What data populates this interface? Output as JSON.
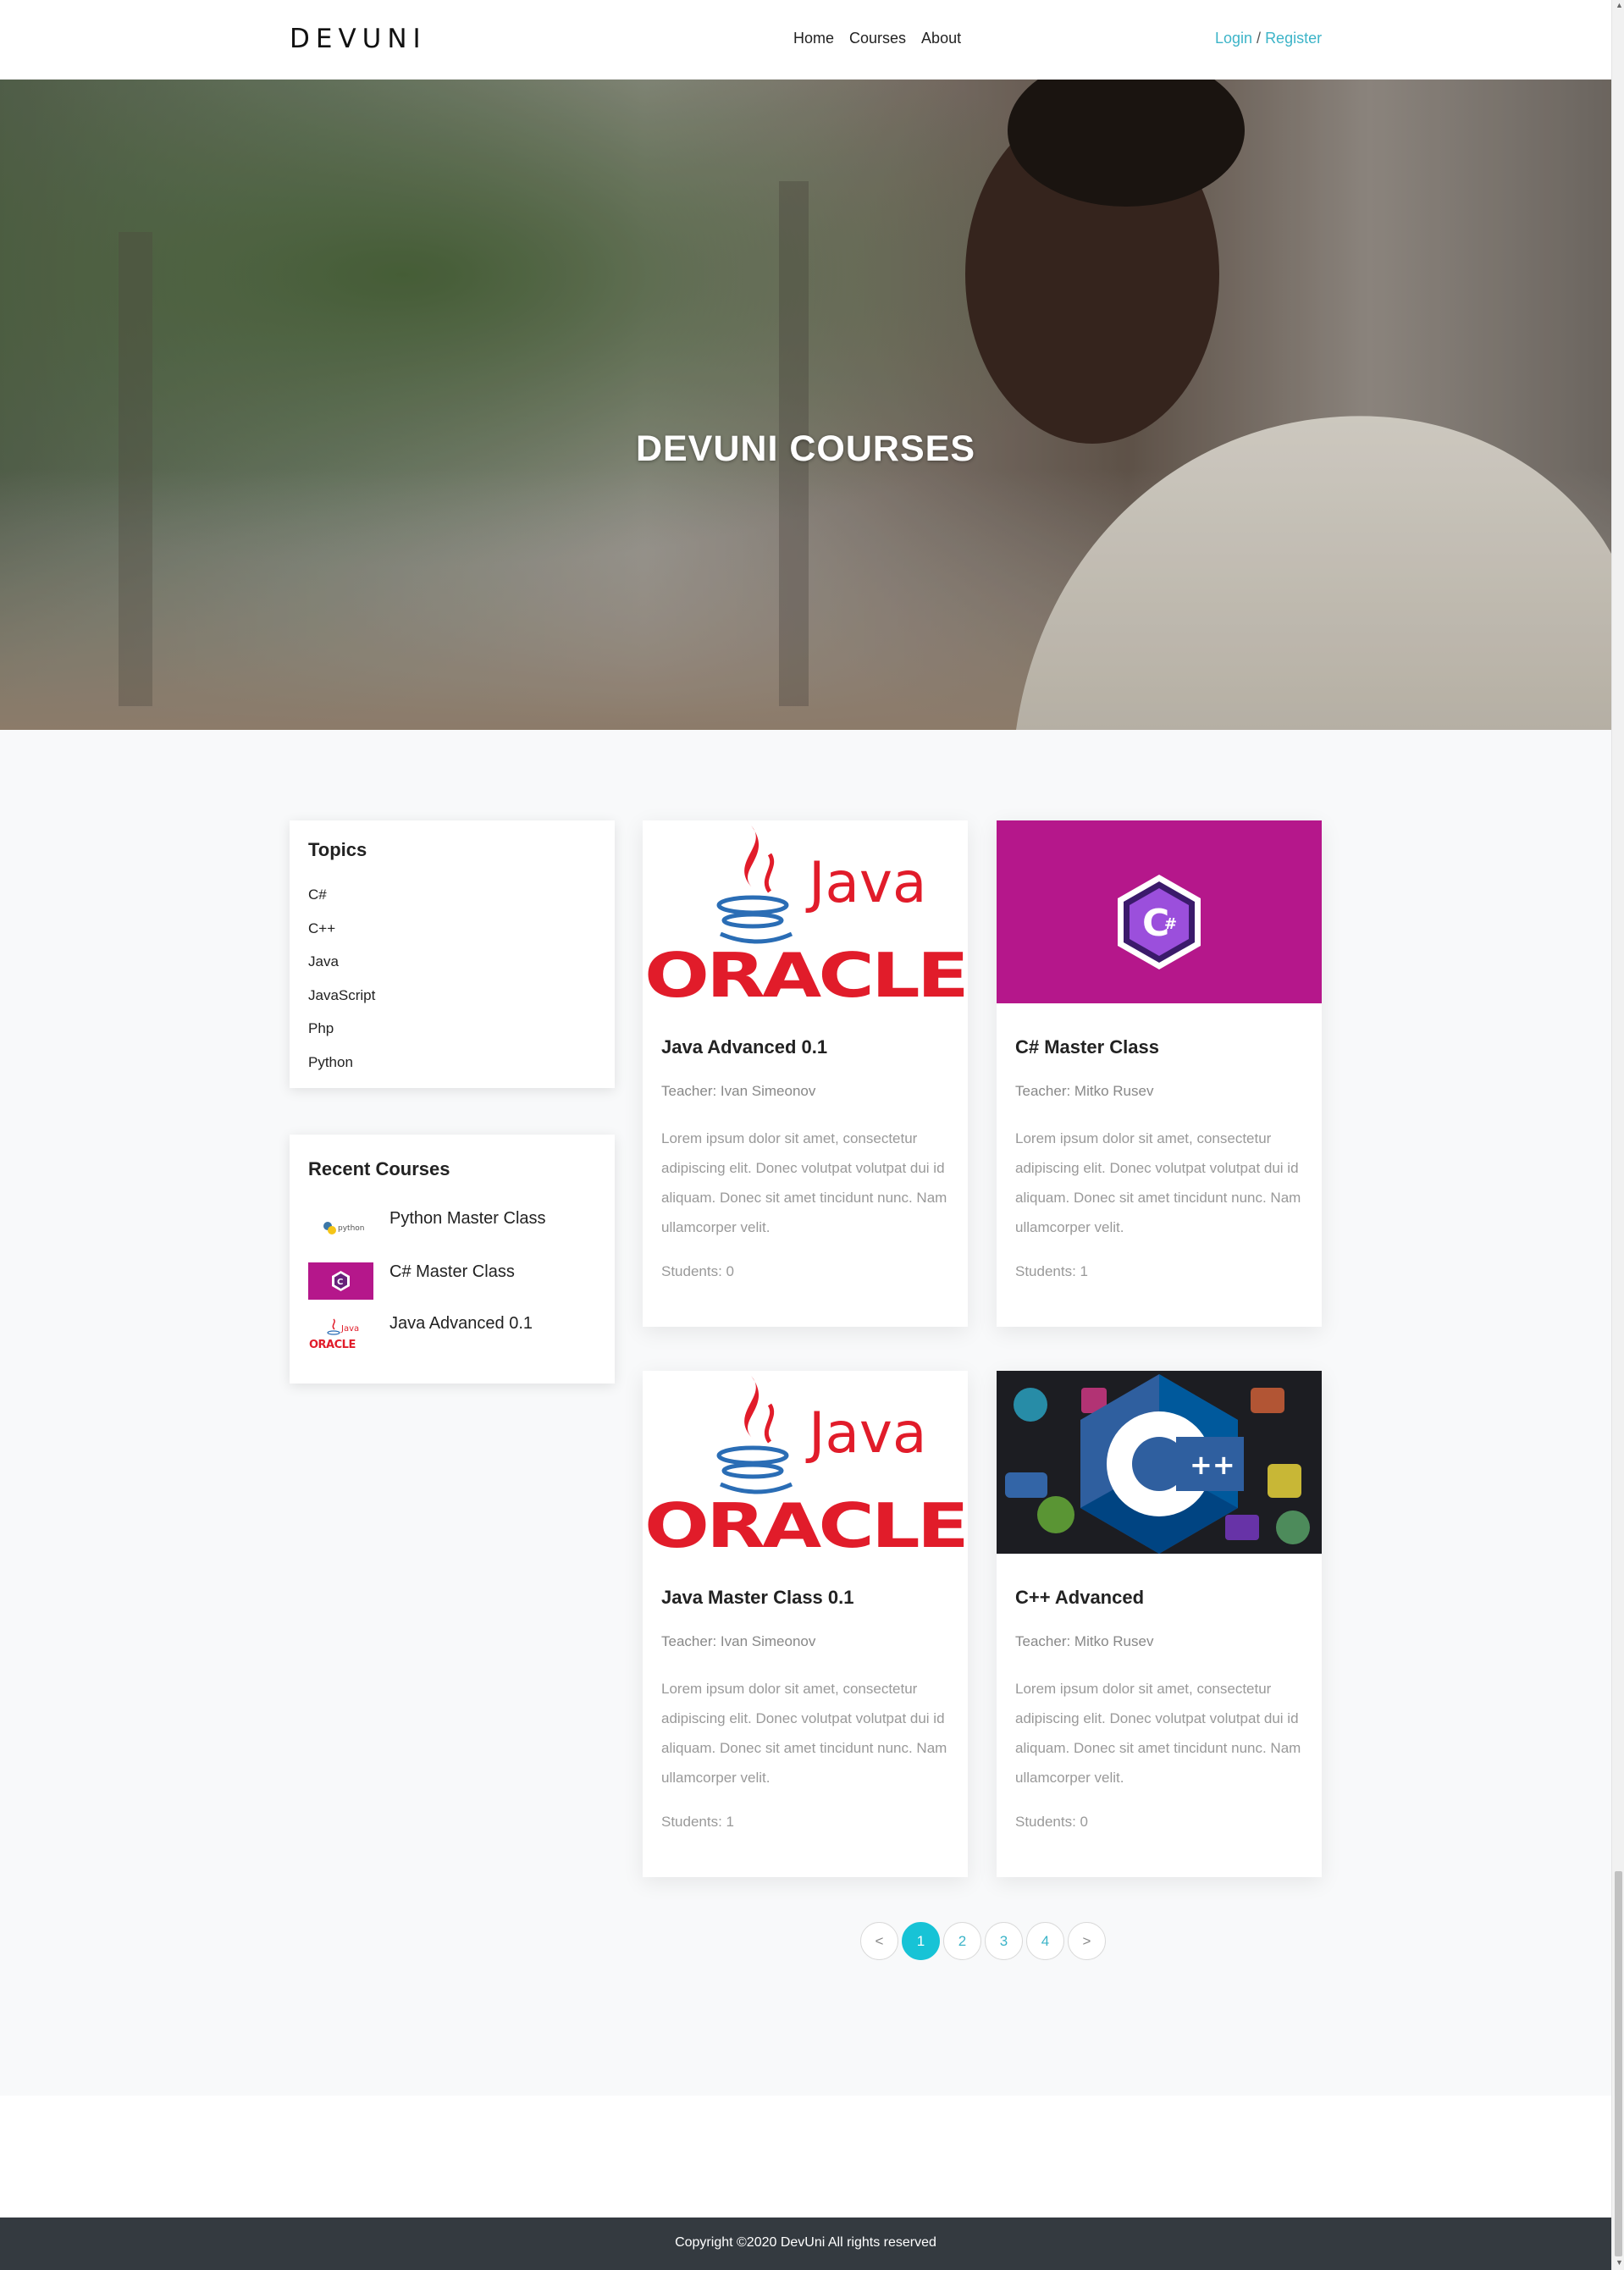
{
  "nav": {
    "brand": "DEVUNI",
    "links": [
      "Home",
      "Courses",
      "About"
    ],
    "login": "Login",
    "separator": " / ",
    "register": "Register"
  },
  "hero": {
    "title": "DEVUNI COURSES"
  },
  "topics": {
    "title": "Topics",
    "items": [
      "C#",
      "C++",
      "Java",
      "JavaScript",
      "Php",
      "Python"
    ]
  },
  "recent": {
    "title": "Recent Courses",
    "items": [
      {
        "label": "Python Master Class",
        "thumb": "python-logo"
      },
      {
        "label": "C# Master Class",
        "thumb": "csharp-logo"
      },
      {
        "label": "Java Advanced 0.1",
        "thumb": "java-oracle-logo"
      }
    ]
  },
  "courses": [
    {
      "title": "Java Advanced 0.1",
      "teacher": "Teacher: Ivan Simeonov",
      "description": "Lorem ipsum dolor sit amet, consectetur adipiscing elit. Donec volutpat volutpat dui id aliquam. Donec sit amet tincidunt nunc. Nam ullamcorper velit.",
      "students": "Students: 0",
      "image": "java-oracle-logo"
    },
    {
      "title": "C# Master Class",
      "teacher": "Teacher: Mitko Rusev",
      "description": "Lorem ipsum dolor sit amet, consectetur adipiscing elit. Donec volutpat volutpat dui id aliquam. Donec sit amet tincidunt nunc. Nam ullamcorper velit.",
      "students": "Students: 1",
      "image": "csharp-logo"
    },
    {
      "title": "Java Master Class 0.1",
      "teacher": "Teacher: Ivan Simeonov",
      "description": "Lorem ipsum dolor sit amet, consectetur adipiscing elit. Donec volutpat volutpat dui id aliquam. Donec sit amet tincidunt nunc. Nam ullamcorper velit.",
      "students": "Students: 1",
      "image": "java-oracle-logo"
    },
    {
      "title": "C++ Advanced",
      "teacher": "Teacher: Mitko Rusev",
      "description": "Lorem ipsum dolor sit amet, consectetur adipiscing elit. Donec volutpat volutpat dui id aliquam. Donec sit amet tincidunt nunc. Nam ullamcorper velit.",
      "students": "Students: 0",
      "image": "cpp-logo"
    }
  ],
  "pagination": {
    "prev": "<",
    "pages": [
      "1",
      "2",
      "3",
      "4"
    ],
    "active": "1",
    "next": ">"
  },
  "footer": {
    "text": "Copyright ©2020 DevUni All rights reserved"
  },
  "colors": {
    "accent": "#17c3d6",
    "link": "#3cb4c8",
    "footer_bg": "#343a40",
    "csharp_bg": "#b5178b",
    "java_red": "#e11c2a",
    "java_blue": "#2a6db5"
  }
}
